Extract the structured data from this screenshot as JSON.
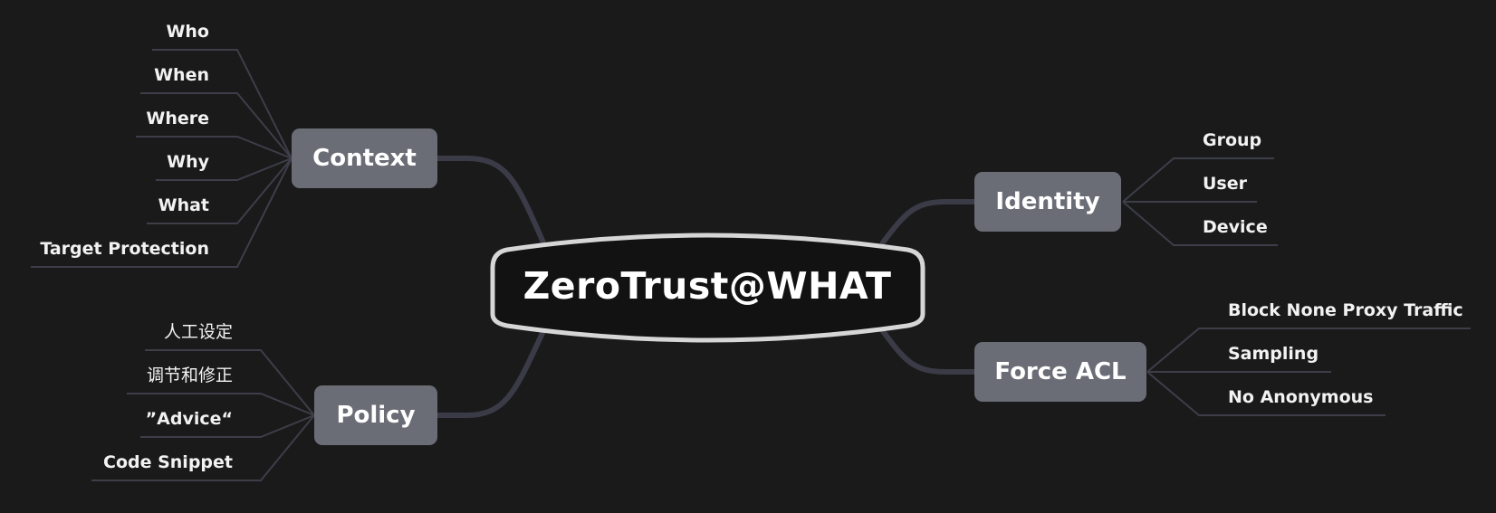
{
  "root": {
    "label": "ZeroTrust@WHAT"
  },
  "branches": {
    "context": {
      "label": "Context",
      "items": [
        "Who",
        "When",
        "Where",
        "Why",
        "What",
        "Target Protection"
      ]
    },
    "policy": {
      "label": "Policy",
      "items": [
        "人工设定",
        "调节和修正",
        "”Advice“",
        "Code Snippet"
      ]
    },
    "identity": {
      "label": "Identity",
      "items": [
        "Group",
        "User",
        "Device"
      ]
    },
    "force_acl": {
      "label": "Force ACL",
      "items": [
        "Block None Proxy Traffic",
        "Sampling",
        "No Anonymous"
      ]
    }
  },
  "colors": {
    "background": "#1a1a1a",
    "branch_fill": "#6b6d76",
    "root_stroke": "#d6d6d6",
    "connector": "#3a3b47",
    "leaf_line": "#3d3e49",
    "text": "#ffffff"
  }
}
